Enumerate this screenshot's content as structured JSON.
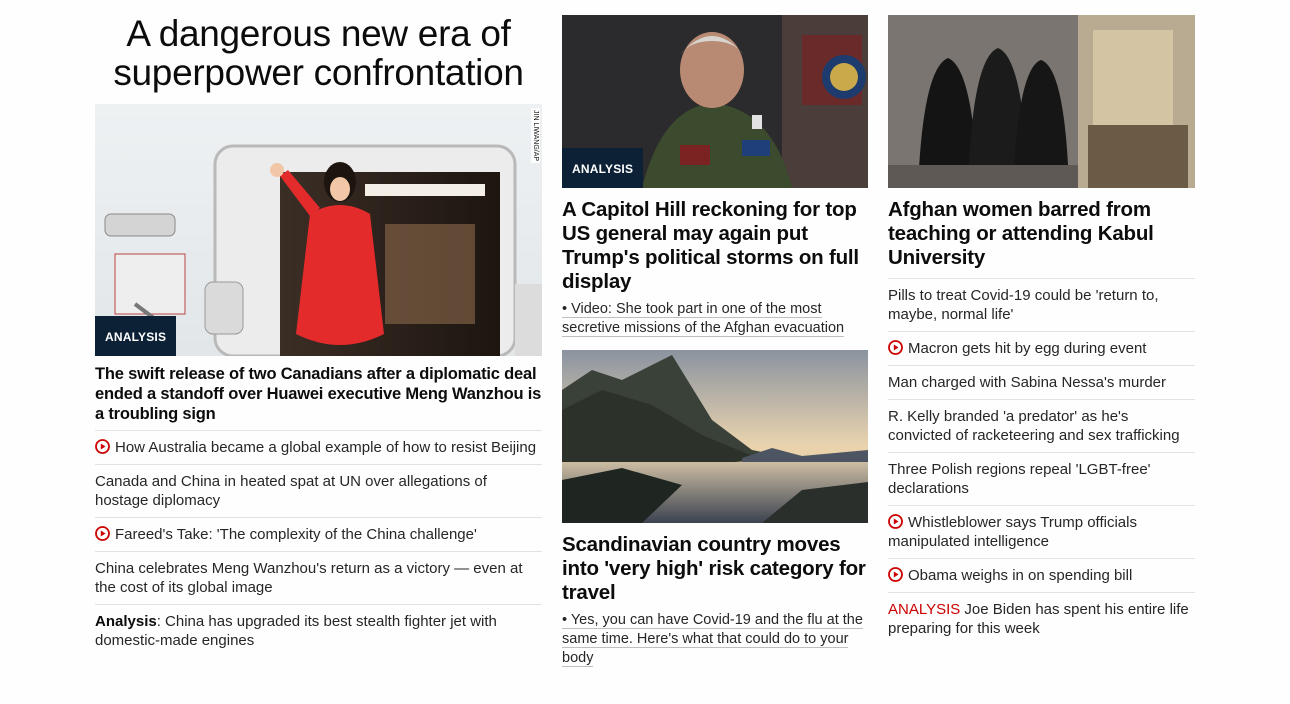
{
  "col1": {
    "headline": "A dangerous new era of superpower confrontation",
    "badge": "ANALYSIS",
    "photo_credit": "JIN LIWANG/AP",
    "title": "The swift release of two Canadians after a diplomatic deal ended a standoff over Huawei executive Meng Wanzhou is a troubling sign",
    "items": [
      {
        "text": "How Australia became a global example of how to resist Beijing",
        "video": true
      },
      {
        "text": "Canada and China in heated spat at UN over allegations of hostage diplomacy",
        "video": false
      },
      {
        "text": "Fareed's Take: 'The complexity of the China challenge'",
        "video": true
      },
      {
        "text": "China celebrates Meng Wanzhou's return as a victory — even at the cost of its global image",
        "video": false
      }
    ],
    "last_item": {
      "bold": "Analysis",
      "text": ": China has upgraded its best stealth fighter jet with domestic-made engines"
    }
  },
  "col2": {
    "story1": {
      "badge": "ANALYSIS",
      "title": "A Capitol Hill reckoning for top US general may again put Trump's political storms on full display",
      "sub": "• Video: She took part in one of the most secretive missions of the Afghan evacuation"
    },
    "story2": {
      "title": "Scandinavian country moves into 'very high' risk category for travel",
      "sub": "• Yes, you can have Covid-19 and the flu at the same time. Here's what that could do to your body"
    }
  },
  "col3": {
    "title": "Afghan women barred from teaching or attending Kabul University",
    "items": [
      {
        "text": "Pills to treat Covid-19 could be 'return to, maybe, normal life'",
        "video": false
      },
      {
        "text": "Macron gets hit by egg during event",
        "video": true
      },
      {
        "text": "Man charged with Sabina Nessa's murder",
        "video": false
      },
      {
        "text": "R. Kelly branded 'a predator' as he's convicted of racketeering and sex trafficking",
        "video": false
      },
      {
        "text": "Three Polish regions repeal 'LGBT-free' declarations",
        "video": false
      },
      {
        "text": "Whistleblower says Trump officials manipulated intelligence",
        "video": true
      },
      {
        "text": "Obama weighs in on spending bill",
        "video": true
      }
    ],
    "last_item": {
      "label": "ANALYSIS",
      "text": " Joe Biden has spent his entire life preparing for this week"
    }
  },
  "colors": {
    "accent_red": "#cc0000",
    "badge_bg": "#0c2135",
    "divider": "#e2e2e2"
  }
}
